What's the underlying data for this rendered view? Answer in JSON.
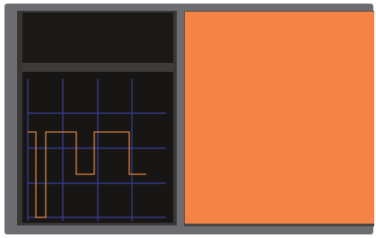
{
  "colors": {
    "frame": "#6c6d70",
    "left_panel": "#3a3634",
    "top_screen": "#1a1917",
    "waveform_background": "#171614",
    "grid": "#3a3f9a",
    "signal": "#d9823e",
    "display": "#f48346"
  },
  "waveform": {
    "signal_levels": [
      "low",
      "high",
      "low",
      "high",
      "low"
    ]
  }
}
